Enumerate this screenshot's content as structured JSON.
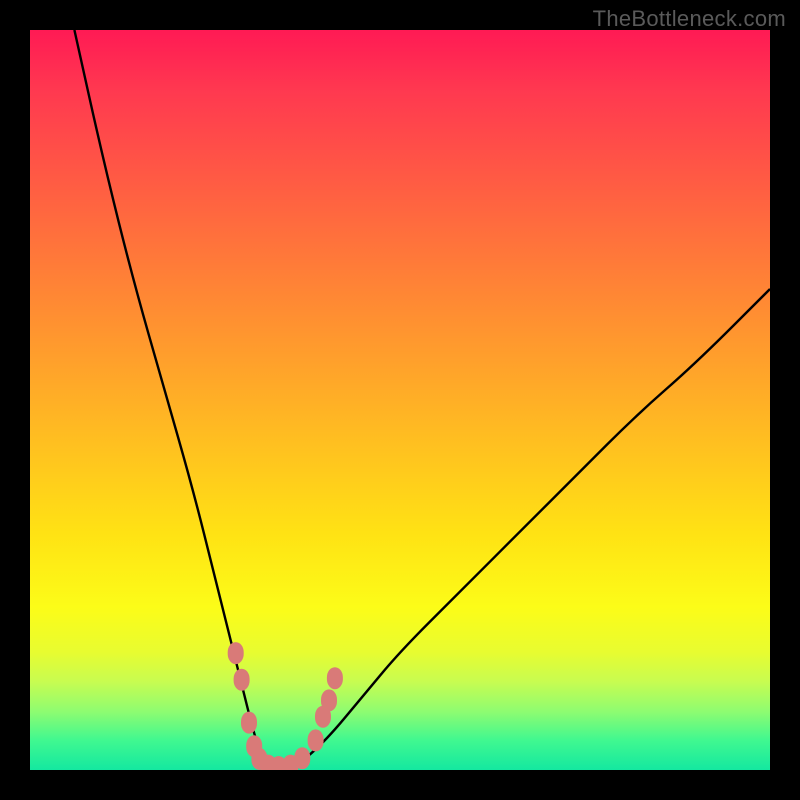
{
  "watermark": "TheBottleneck.com",
  "chart_data": {
    "type": "line",
    "title": "",
    "xlabel": "",
    "ylabel": "",
    "xlim": [
      0,
      100
    ],
    "ylim": [
      0,
      100
    ],
    "background_gradient": {
      "stops": [
        {
          "pos": 0.0,
          "color": "#ff1a54"
        },
        {
          "pos": 0.08,
          "color": "#ff3850"
        },
        {
          "pos": 0.2,
          "color": "#ff5a44"
        },
        {
          "pos": 0.32,
          "color": "#ff7c38"
        },
        {
          "pos": 0.44,
          "color": "#ff9e2c"
        },
        {
          "pos": 0.56,
          "color": "#ffc020"
        },
        {
          "pos": 0.68,
          "color": "#ffe214"
        },
        {
          "pos": 0.78,
          "color": "#fcfc18"
        },
        {
          "pos": 0.84,
          "color": "#e8fc30"
        },
        {
          "pos": 0.88,
          "color": "#c8fc50"
        },
        {
          "pos": 0.92,
          "color": "#90fc70"
        },
        {
          "pos": 0.96,
          "color": "#40f890"
        },
        {
          "pos": 1.0,
          "color": "#14e8a0"
        }
      ]
    },
    "series": [
      {
        "name": "v-curve",
        "stroke": "#000000",
        "x": [
          6,
          10,
          14,
          18,
          22,
          25,
          27,
          29,
          30.5,
          32,
          34,
          36,
          40,
          45,
          50,
          58,
          66,
          74,
          82,
          90,
          100
        ],
        "y": [
          100,
          82,
          66,
          52,
          38,
          26,
          18,
          10,
          4,
          0.5,
          0.2,
          0.5,
          4,
          10,
          16,
          24,
          32,
          40,
          48,
          55,
          65
        ]
      }
    ],
    "markers": {
      "name": "data-points",
      "color": "#d97a78",
      "shape": "rounded-rect",
      "points": [
        {
          "x": 27.8,
          "y": 15.8
        },
        {
          "x": 28.6,
          "y": 12.2
        },
        {
          "x": 29.6,
          "y": 6.4
        },
        {
          "x": 30.3,
          "y": 3.2
        },
        {
          "x": 31.0,
          "y": 1.5
        },
        {
          "x": 32.2,
          "y": 0.6
        },
        {
          "x": 33.6,
          "y": 0.4
        },
        {
          "x": 35.2,
          "y": 0.6
        },
        {
          "x": 36.8,
          "y": 1.6
        },
        {
          "x": 38.6,
          "y": 4.0
        },
        {
          "x": 39.6,
          "y": 7.2
        },
        {
          "x": 40.4,
          "y": 9.4
        },
        {
          "x": 41.2,
          "y": 12.4
        }
      ]
    }
  }
}
